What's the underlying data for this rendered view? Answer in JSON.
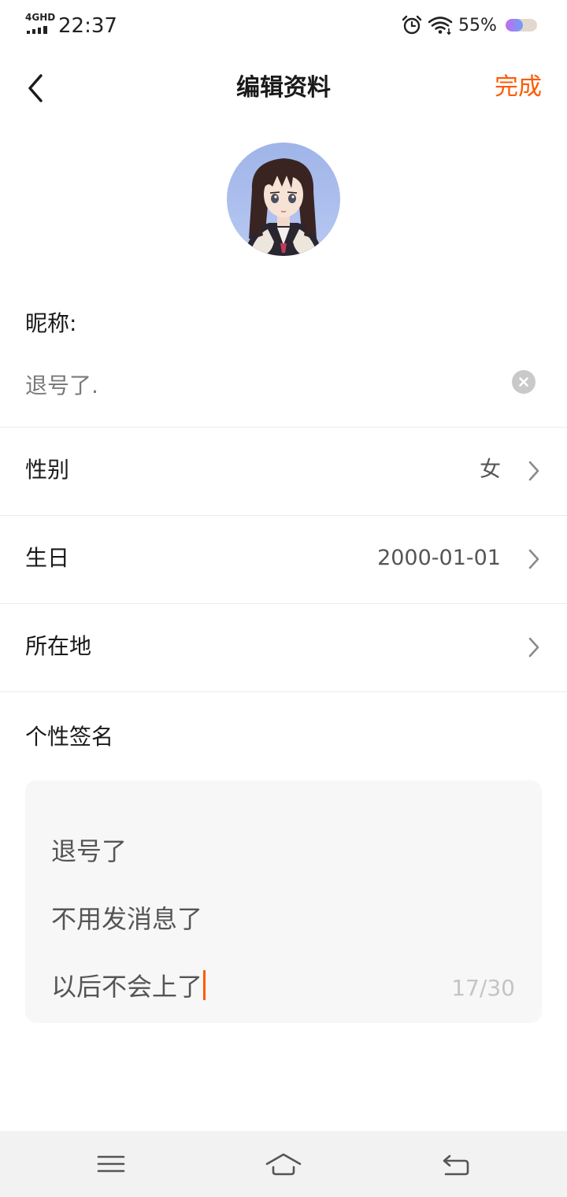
{
  "status_bar": {
    "network": "4GHD",
    "time": "22:37",
    "battery_percent": "55%",
    "battery_level": 0.55,
    "icons": [
      "signal-icon",
      "alarm-icon",
      "wifi-icon",
      "battery-icon"
    ]
  },
  "header": {
    "title": "编辑资料",
    "done_label": "完成",
    "back_icon": "chevron-left-icon"
  },
  "profile": {
    "avatar": "anime-girl-avatar",
    "nickname_label": "昵称:",
    "nickname_value": "退号了.",
    "clear_icon": "clear-icon"
  },
  "rows": {
    "gender": {
      "label": "性别",
      "value": "女"
    },
    "birthday": {
      "label": "生日",
      "value": "2000-01-01"
    },
    "location": {
      "label": "所在地",
      "value": ""
    }
  },
  "signature": {
    "label": "个性签名",
    "lines": [
      "退号了",
      "不用发消息了",
      "以后不会上了"
    ],
    "counter": "17/30"
  },
  "nav_bar": {
    "icons": [
      "menu-icon",
      "home-icon",
      "back-icon"
    ]
  },
  "colors": {
    "accent": "#ff5a00",
    "divider": "#ebebeb",
    "text_primary": "#1a1a1a",
    "text_secondary": "#555555",
    "nav_background": "#f2f2f2"
  }
}
